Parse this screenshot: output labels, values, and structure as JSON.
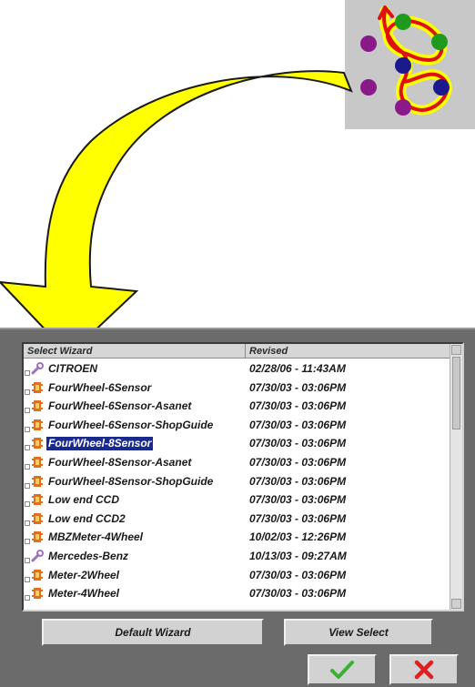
{
  "icons": {
    "wizard": "wizard-graph-icon",
    "arrow": "curved-arrow-icon",
    "ok": "checkmark-icon",
    "cancel": "x-icon"
  },
  "colors": {
    "arrow_fill": "#ffff00",
    "panel_bg": "#6b6b6b",
    "selection_bg": "#1a2a8c",
    "ok_green": "#3cb034",
    "cancel_red": "#e02020"
  },
  "list": {
    "columns": [
      "Select Wizard",
      "Revised"
    ],
    "selected_index": 4,
    "rows": [
      {
        "name": "CITROEN",
        "revised": "02/28/06  - 11:43AM",
        "icon": "wrench-icon"
      },
      {
        "name": "FourWheel-6Sensor",
        "revised": "07/30/03  - 03:06PM",
        "icon": "sensor-icon"
      },
      {
        "name": "FourWheel-6Sensor-Asanet",
        "revised": "07/30/03  - 03:06PM",
        "icon": "sensor-icon"
      },
      {
        "name": "FourWheel-6Sensor-ShopGuide",
        "revised": "07/30/03  - 03:06PM",
        "icon": "sensor-icon"
      },
      {
        "name": "FourWheel-8Sensor",
        "revised": "07/30/03  - 03:06PM",
        "icon": "sensor-icon"
      },
      {
        "name": "FourWheel-8Sensor-Asanet",
        "revised": "07/30/03  - 03:06PM",
        "icon": "sensor-icon"
      },
      {
        "name": "FourWheel-8Sensor-ShopGuide",
        "revised": "07/30/03  - 03:06PM",
        "icon": "sensor-icon"
      },
      {
        "name": "Low end CCD",
        "revised": "07/30/03  - 03:06PM",
        "icon": "sensor-icon"
      },
      {
        "name": "Low end CCD2",
        "revised": "07/30/03  - 03:06PM",
        "icon": "sensor-icon"
      },
      {
        "name": "MBZMeter-4Wheel",
        "revised": "10/02/03  - 12:26PM",
        "icon": "sensor-icon"
      },
      {
        "name": "Mercedes-Benz",
        "revised": "10/13/03  - 09:27AM",
        "icon": "wrench-icon"
      },
      {
        "name": "Meter-2Wheel",
        "revised": "07/30/03  - 03:06PM",
        "icon": "sensor-icon"
      },
      {
        "name": "Meter-4Wheel",
        "revised": "07/30/03  - 03:06PM",
        "icon": "sensor-icon"
      }
    ]
  },
  "buttons": {
    "default_wizard": "Default Wizard",
    "view_select": "View Select"
  }
}
